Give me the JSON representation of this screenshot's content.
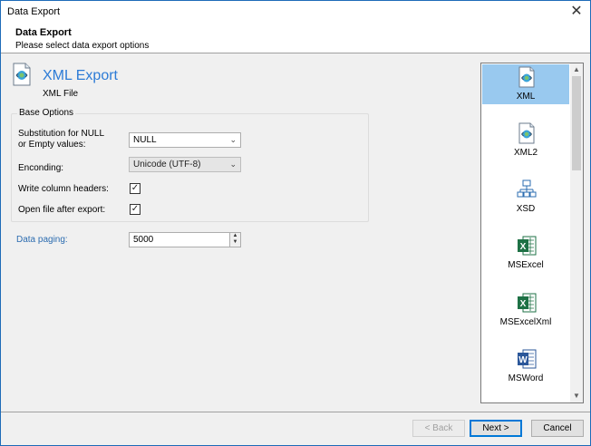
{
  "window": {
    "title": "Data Export"
  },
  "header": {
    "title": "Data Export",
    "subtitle": "Please select data export options"
  },
  "export": {
    "title": "XML Export",
    "subtitle": "XML File"
  },
  "base_options": {
    "group_label": "Base Options",
    "null_label_line1": "Substitution for NULL",
    "null_label_line2": "or Empty values:",
    "null_value": "NULL",
    "encoding_label": "Enconding:",
    "encoding_value": "Unicode (UTF-8)",
    "write_headers_label": "Write column headers:",
    "write_headers_checked": true,
    "open_file_label": "Open file after export:",
    "open_file_checked": true
  },
  "paging": {
    "label": "Data paging:",
    "value": "5000"
  },
  "formats": [
    {
      "label": "XML",
      "icon": "xml-file-icon",
      "selected": true
    },
    {
      "label": "XML2",
      "icon": "xml-file-icon",
      "selected": false
    },
    {
      "label": "XSD",
      "icon": "xsd-schema-icon",
      "selected": false
    },
    {
      "label": "MSExcel",
      "icon": "excel-icon",
      "selected": false
    },
    {
      "label": "MSExcelXml",
      "icon": "excel-icon",
      "selected": false
    },
    {
      "label": "MSWord",
      "icon": "word-icon",
      "selected": false
    }
  ],
  "buttons": {
    "back": "< Back",
    "next": "Next >",
    "cancel": "Cancel"
  },
  "colors": {
    "accent": "#2c7bd6",
    "selection": "#99c9ef",
    "excel": "#1e7145",
    "word": "#2b579a"
  }
}
